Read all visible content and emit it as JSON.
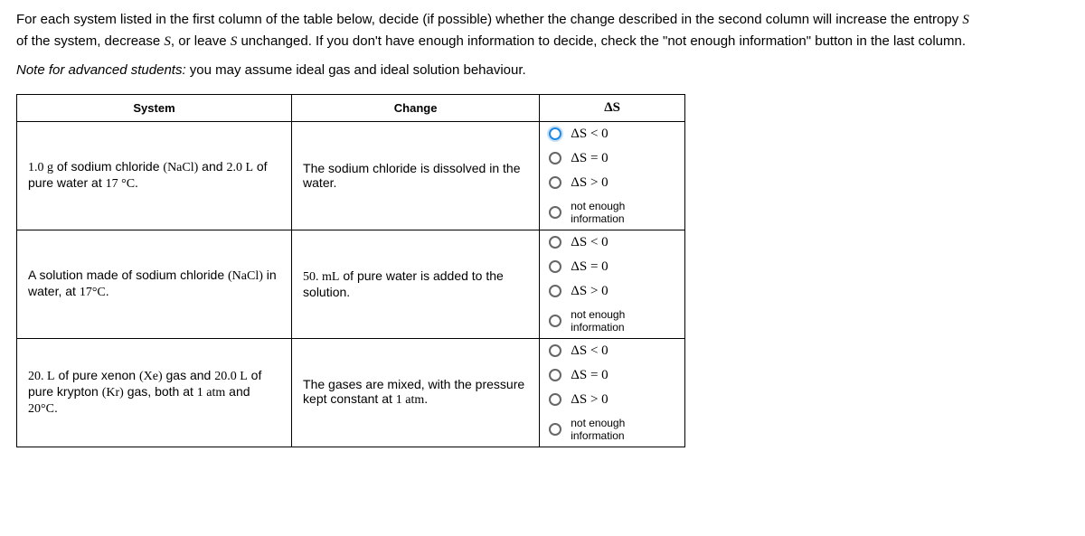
{
  "instructions": {
    "l1": "For each system listed in the first column of the table below, decide (if possible) whether the change described in the second column will increase the entropy",
    "var": "S",
    "l2a": "of the system, decrease ",
    "l2b": ", or leave ",
    "l2c": " unchanged. If you don't have enough information to decide, check the \"not enough information\" button in the last column."
  },
  "note": {
    "em": "Note for advanced students:",
    "rest": " you may assume ideal gas and ideal solution behaviour."
  },
  "headers": {
    "system": "System",
    "change": "Change",
    "ds": "ΔS"
  },
  "options": {
    "lt": "ΔS < 0",
    "eq": "ΔS = 0",
    "gt": "ΔS > 0",
    "nei": "not enough information"
  },
  "rows": [
    {
      "system": {
        "a": "1.0 g",
        "b": " of sodium chloride ",
        "c": "(NaCl)",
        "d": " and ",
        "e": "2.0 L",
        "f": " of pure water at ",
        "g": "17 °C",
        "h": "."
      },
      "change": "The sodium chloride is dissolved in the water.",
      "selected": "lt"
    },
    {
      "system": {
        "a": "A solution made of sodium chloride ",
        "b": "(NaCl)",
        "c": " in water, at ",
        "d": "17°C",
        "e": "."
      },
      "change": {
        "a": "50. mL",
        "b": " of pure water is added to the solution."
      },
      "selected": null
    },
    {
      "system": {
        "a": "20. L",
        "b": " of pure xenon ",
        "c": "(Xe)",
        "d": " gas and ",
        "e": "20.0 L",
        "f": " of pure krypton ",
        "g": "(Kr)",
        "h": " gas, both at ",
        "i": "1 atm",
        "j": " and ",
        "k": "20°C",
        "l": "."
      },
      "change": {
        "a": "The gases are mixed, with the pressure kept constant at ",
        "b": "1 atm",
        "c": "."
      },
      "selected": null
    }
  ]
}
